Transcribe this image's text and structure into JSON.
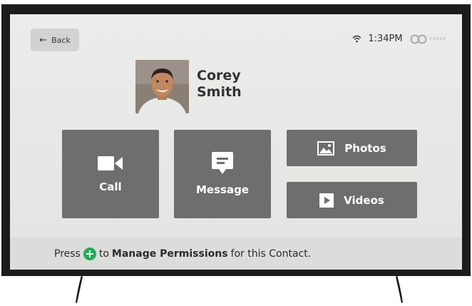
{
  "header": {
    "back_label": "Back",
    "time": "1:34PM",
    "brand": "CAAVO"
  },
  "contact": {
    "first_name": "Corey",
    "last_name": "Smith"
  },
  "actions": {
    "call_label": "Call",
    "message_label": "Message",
    "photos_label": "Photos",
    "videos_label": "Videos"
  },
  "footer": {
    "press": "Press",
    "to": "to",
    "manage_permissions": "Manage Permissions",
    "suffix": "for this Contact."
  },
  "icons": {
    "back": "arrow-left-icon",
    "wifi": "wifi-icon",
    "brand": "caavo-logo-icon",
    "call": "video-camera-icon",
    "message": "chat-bubble-icon",
    "photos": "image-icon",
    "videos": "play-icon",
    "plus": "plus-icon"
  },
  "colors": {
    "tile": "#6e6e6e",
    "plus_button": "#27a85b",
    "screen_bg": "#e8e8e6",
    "bezel": "#1c1c1c"
  }
}
